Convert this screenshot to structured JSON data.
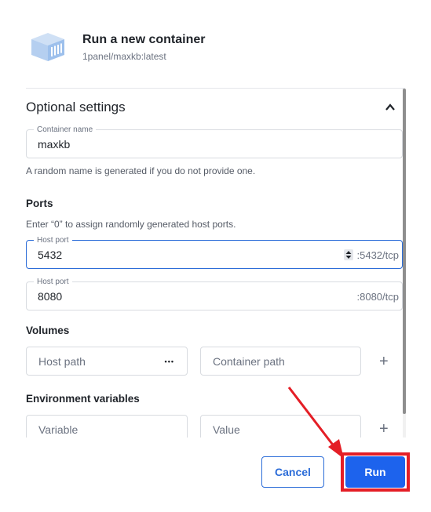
{
  "header": {
    "title": "Run a new container",
    "subtitle": "1panel/maxkb:latest"
  },
  "optional": {
    "title": "Optional settings"
  },
  "container_name": {
    "label": "Container name",
    "value": "maxkb",
    "hint": "A random name is generated if you do not provide one."
  },
  "ports": {
    "title": "Ports",
    "hint": "Enter “0” to assign randomly generated host ports.",
    "items": [
      {
        "label": "Host port",
        "value": "5432",
        "suffix": ":5432/tcp"
      },
      {
        "label": "Host port",
        "value": "8080",
        "suffix": ":8080/tcp"
      }
    ]
  },
  "volumes": {
    "title": "Volumes",
    "host_path_placeholder": "Host path",
    "container_path_placeholder": "Container path",
    "browse_label": "•••",
    "add_label": "+"
  },
  "env": {
    "title": "Environment variables",
    "variable_placeholder": "Variable",
    "value_placeholder": "Value",
    "add_label": "+"
  },
  "actions": {
    "cancel_label": "Cancel",
    "run_label": "Run"
  },
  "colors": {
    "accent": "#1d63ed",
    "highlight": "#e41e26"
  }
}
